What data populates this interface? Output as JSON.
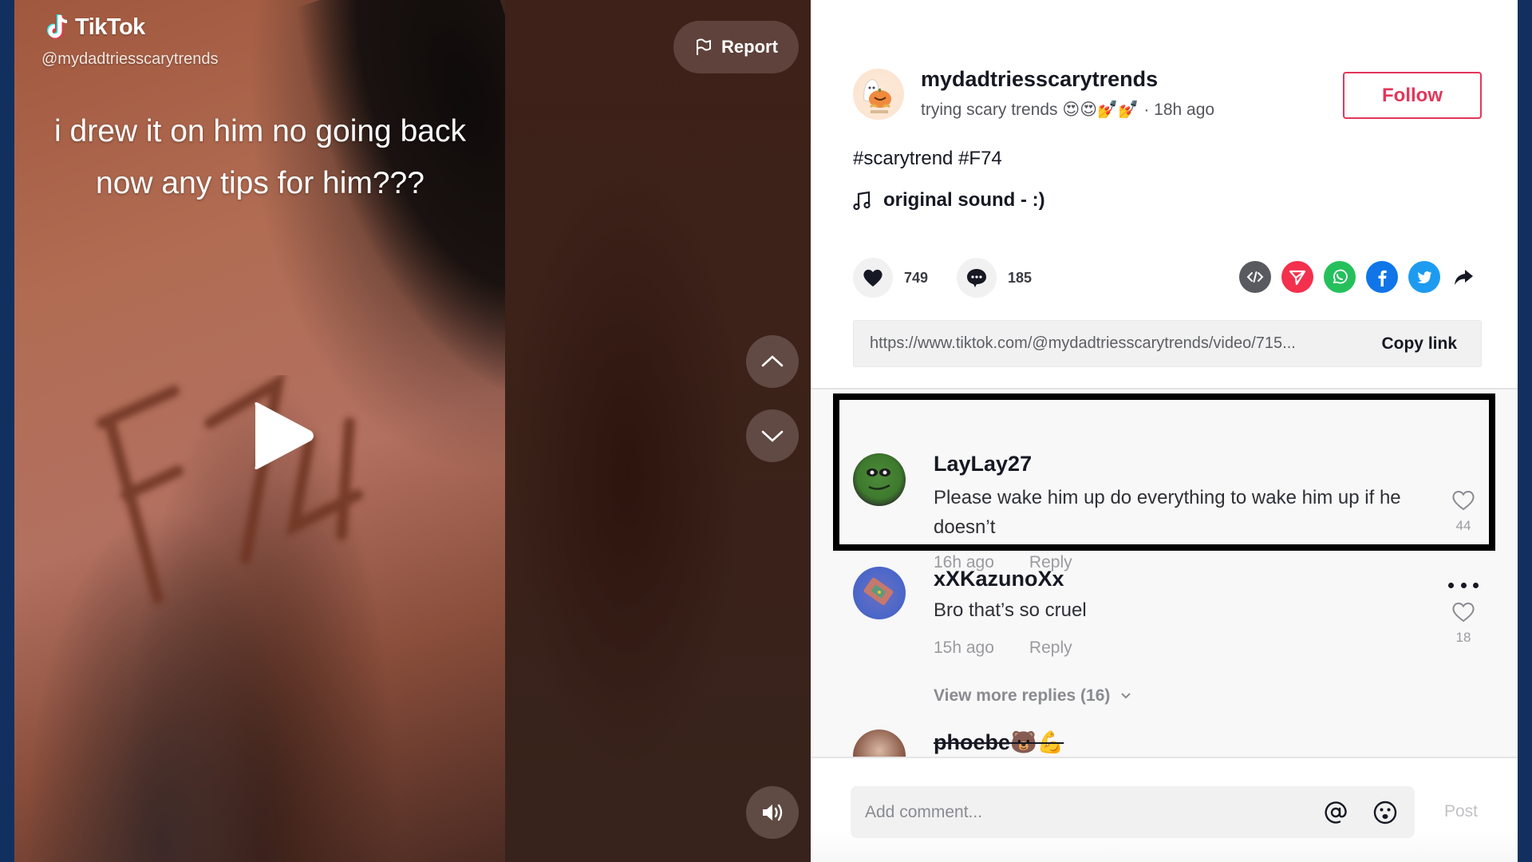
{
  "video": {
    "brand": "TikTok",
    "handle": "@mydadtriesscarytrends",
    "caption": "i drew it on him no going back now any tips for him???",
    "drawn_text": "F74",
    "report_label": "Report",
    "icons": {
      "play": "play-icon",
      "prev": "chevron-up-icon",
      "next": "chevron-down-icon",
      "volume": "volume-icon",
      "report": "flag-icon"
    }
  },
  "post": {
    "author": "mydadtriesscarytrends",
    "subtitle": "trying scary trends 😍😍💅💅",
    "time": "18h ago",
    "follow_label": "Follow",
    "hashtags": [
      "#scarytrend",
      "#F74"
    ],
    "sound": "original sound - :)",
    "likes": "749",
    "comments": "185",
    "share": [
      {
        "name": "embed",
        "color": "#585a60"
      },
      {
        "name": "send-to-friends",
        "color": "#f3304d"
      },
      {
        "name": "whatsapp",
        "color": "#25c05c"
      },
      {
        "name": "facebook",
        "color": "#0f75e8"
      },
      {
        "name": "twitter",
        "color": "#1d9bf0"
      }
    ],
    "link_url": "https://www.tiktok.com/@mydadtriesscarytrends/video/715...",
    "copy_link_label": "Copy link"
  },
  "comments": [
    {
      "user": "LayLay27",
      "text": "Please wake him up do everything to wake him up if he doesn’t",
      "time": "16h ago",
      "reply": "Reply",
      "likes": "44",
      "highlighted": true
    },
    {
      "user": "xXKazunoXx",
      "text": "Bro that’s so cruel",
      "time": "15h ago",
      "reply": "Reply",
      "likes": "18",
      "view_more": "View more replies (16)"
    },
    {
      "user": "phoebe🐻💪"
    }
  ],
  "composer": {
    "placeholder": "Add comment...",
    "post_label": "Post"
  },
  "colors": {
    "accent": "#e3365a",
    "frame": "#12305f"
  }
}
